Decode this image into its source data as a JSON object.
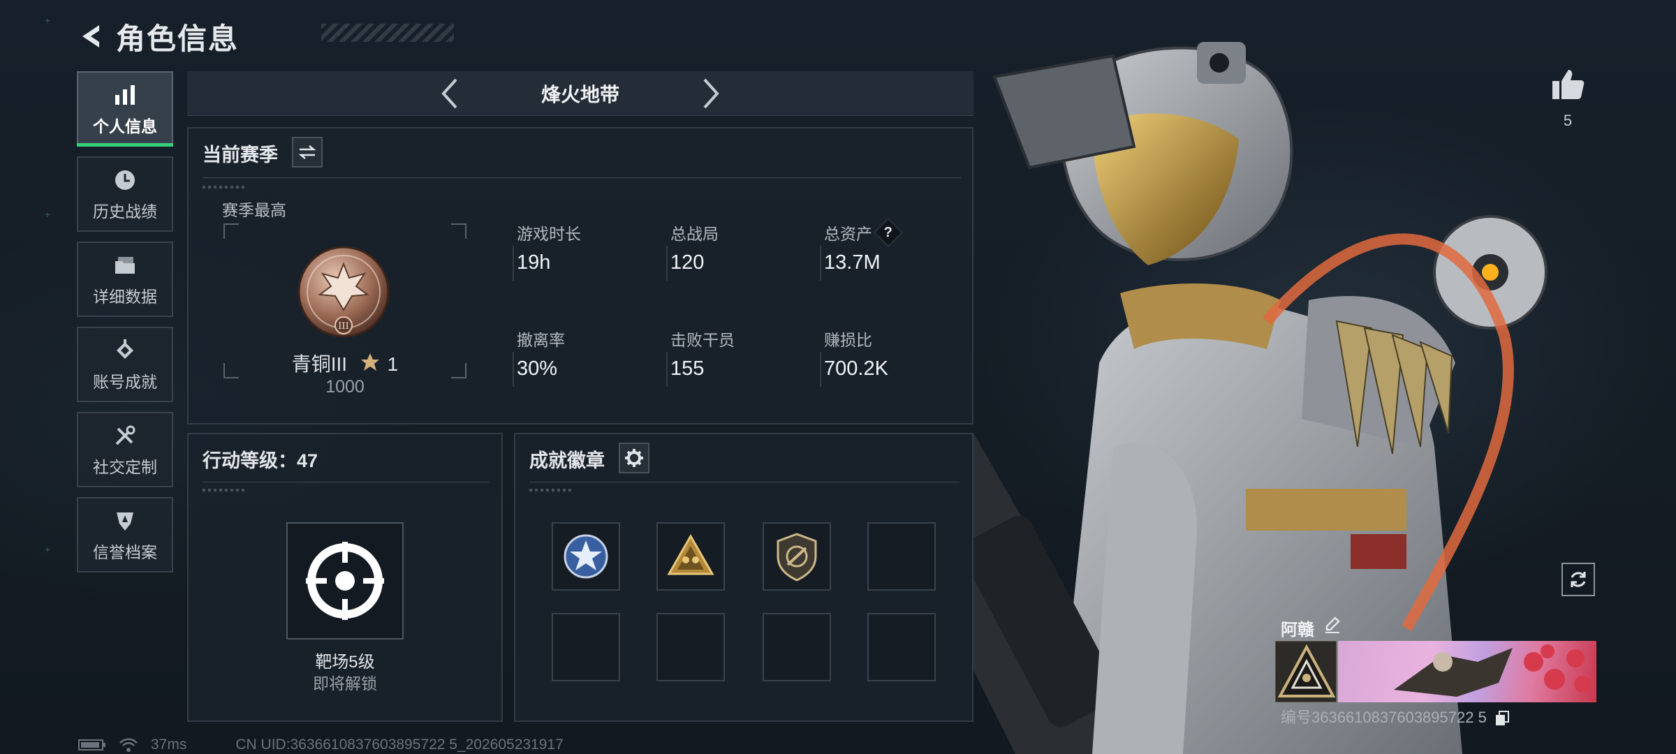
{
  "header": {
    "title": "角色信息"
  },
  "sidebar": {
    "items": [
      {
        "label": "个人信息",
        "icon": "bar-chart-icon",
        "active": true
      },
      {
        "label": "历史战绩",
        "icon": "history-clock-icon",
        "active": false
      },
      {
        "label": "详细数据",
        "icon": "folder-icon",
        "active": false
      },
      {
        "label": "账号成就",
        "icon": "achievement-diamond-icon",
        "active": false
      },
      {
        "label": "社交定制",
        "icon": "tools-icon",
        "active": false
      },
      {
        "label": "信誉档案",
        "icon": "shield-badge-icon",
        "active": false
      }
    ]
  },
  "mode": {
    "label": "烽火地带"
  },
  "season": {
    "title": "当前赛季",
    "best_label": "赛季最高",
    "rank": {
      "name": "青铜III",
      "stars": "1",
      "score": "1000"
    },
    "stats": [
      {
        "label": "游戏时长",
        "value": "19h"
      },
      {
        "label": "总战局",
        "value": "120"
      },
      {
        "label": "总资产",
        "value": "13.7M",
        "help": "?"
      },
      {
        "label": "撤离率",
        "value": "30%"
      },
      {
        "label": "击败干员",
        "value": "155"
      },
      {
        "label": "赚损比",
        "value": "700.2K"
      }
    ]
  },
  "action_level": {
    "title": "行动等级：47",
    "range_name": "靶场5级",
    "range_status": "即将解锁"
  },
  "badges": {
    "title": "成就徽章",
    "slots": [
      {
        "icon": "star-emblem-icon",
        "filled": true
      },
      {
        "icon": "pyramid-squad-icon",
        "filled": true
      },
      {
        "icon": "shield-crosshair-icon",
        "filled": true
      },
      {
        "icon": "",
        "filled": false
      },
      {
        "icon": "",
        "filled": false
      },
      {
        "icon": "",
        "filled": false
      },
      {
        "icon": "",
        "filled": false
      },
      {
        "icon": "",
        "filled": false
      }
    ]
  },
  "profile": {
    "likes": "5",
    "player_name": "阿赣",
    "player_id": "编号3636610837603895722 5"
  },
  "status": {
    "ping": "37ms",
    "uid": "CN UID:3636610837603895722 5_202605231917"
  },
  "colors": {
    "accent_green": "#37d07a",
    "panel_bg": "#1b232c",
    "border": "#333c46"
  }
}
